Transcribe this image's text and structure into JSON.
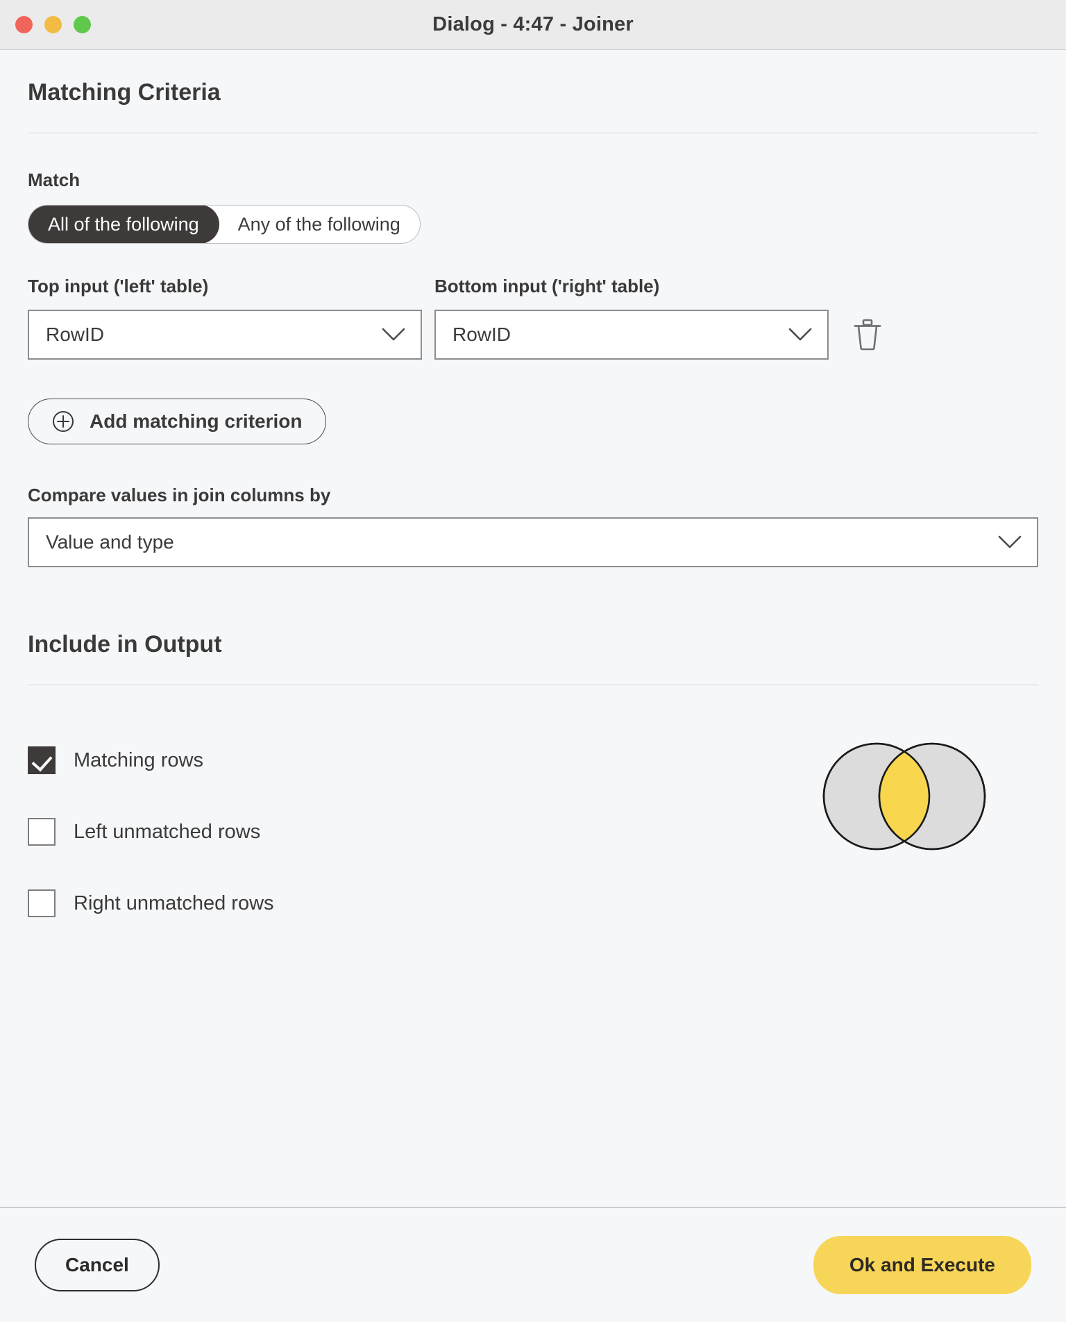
{
  "window": {
    "title": "Dialog - 4:47 - Joiner",
    "traffic_lights": [
      "close-button",
      "minimize-button",
      "zoom-button"
    ]
  },
  "matching_criteria": {
    "heading": "Matching Criteria",
    "match": {
      "label": "Match",
      "options": [
        "All of the following",
        "Any of the following"
      ],
      "selected": "All of the following"
    },
    "criterion": {
      "left_label": "Top input ('left' table)",
      "right_label": "Bottom input ('right' table)",
      "left_value": "RowID",
      "right_value": "RowID",
      "delete_icon": "trash-icon"
    },
    "add_button": {
      "label": "Add matching criterion",
      "icon": "plus-circle-icon"
    },
    "compare": {
      "label": "Compare values in join columns by",
      "value": "Value and type"
    }
  },
  "include_output": {
    "heading": "Include in Output",
    "checkboxes": [
      {
        "label": "Matching rows",
        "checked": true
      },
      {
        "label": "Left unmatched rows",
        "checked": false
      },
      {
        "label": "Right unmatched rows",
        "checked": false
      }
    ],
    "venn": {
      "name": "inner-join-venn-diagram",
      "circle_fill": "#dcdcdc",
      "intersection_fill": "#f8d64e",
      "stroke": "#1a1a1a"
    }
  },
  "footer": {
    "cancel_label": "Cancel",
    "ok_label": "Ok and Execute"
  },
  "colors": {
    "background": "#f6f7f9",
    "titlebar": "#ecebeb",
    "accent_yellow": "#f7d558",
    "dark": "#3e3a39"
  }
}
